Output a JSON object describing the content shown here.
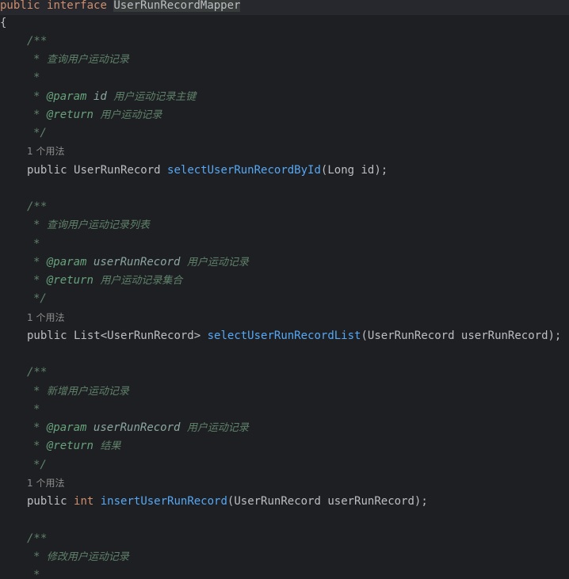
{
  "header": {
    "kw_public": "public",
    "kw_interface": "interface",
    "name": "UserRunRecordMapper"
  },
  "open_brace": "{",
  "comment_open": "/**",
  "comment_star": "*",
  "comment_close": "*/",
  "tag_param": "@param",
  "tag_return": "@return",
  "usage": "1 个用法",
  "kw_public": "public",
  "paren_open": "(",
  "blocks": [
    {
      "summary": "查询用户运动记录",
      "param_name": "id",
      "param_desc": "用户运动记录主键",
      "return_desc": "用户运动记录",
      "return_type": "UserRunRecord",
      "method_name": "selectUserRunRecordById",
      "args": "Long id);"
    },
    {
      "summary": "查询用户运动记录列表",
      "param_name": "userRunRecord",
      "param_desc": "用户运动记录",
      "return_desc": "用户运动记录集合",
      "return_type": "List<UserRunRecord>",
      "method_name": "selectUserRunRecordList",
      "args": "UserRunRecord userRunRecord);"
    },
    {
      "summary": "新增用户运动记录",
      "param_name": "userRunRecord",
      "param_desc": "用户运动记录",
      "return_desc": "结果",
      "return_type": "int",
      "method_name": "insertUserRunRecord",
      "args": "UserRunRecord userRunRecord);"
    },
    {
      "summary": "修改用户运动记录"
    }
  ]
}
